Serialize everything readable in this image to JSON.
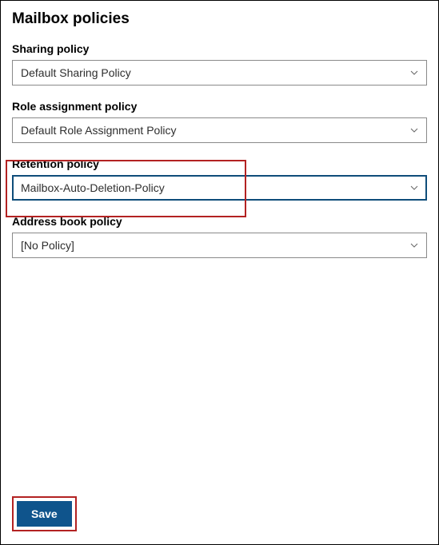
{
  "page_title": "Mailbox policies",
  "fields": {
    "sharing": {
      "label": "Sharing policy",
      "value": "Default Sharing Policy"
    },
    "role_assignment": {
      "label": "Role assignment policy",
      "value": "Default Role Assignment Policy"
    },
    "retention": {
      "label": "Retention policy",
      "value": "Mailbox-Auto-Deletion-Policy"
    },
    "address_book": {
      "label": "Address book policy",
      "value": "[No Policy]"
    }
  },
  "buttons": {
    "save": "Save"
  }
}
